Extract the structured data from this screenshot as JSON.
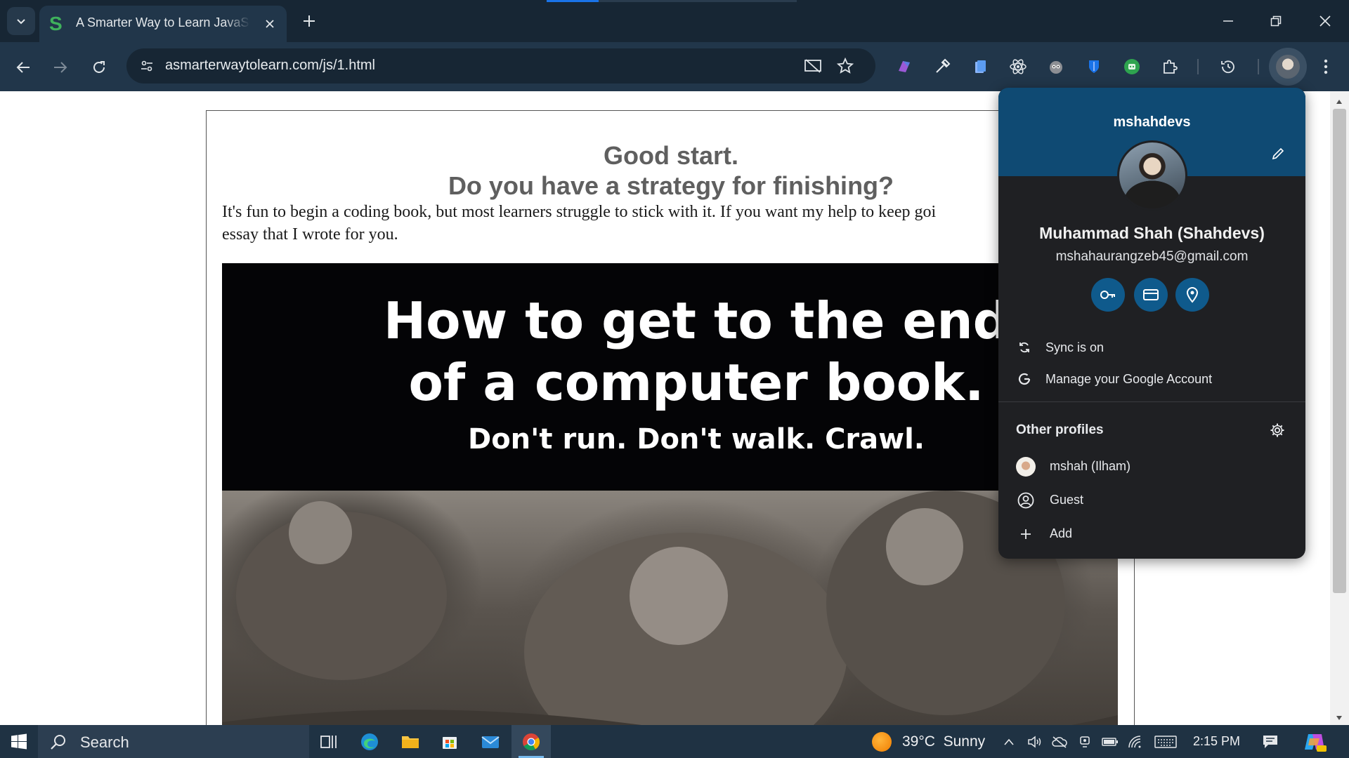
{
  "browser": {
    "tab": {
      "title": "A Smarter Way to Learn JavaScript",
      "favicon_letter": "S"
    },
    "url": "asmarterwaytolearn.com/js/1.html"
  },
  "page": {
    "heading_line1": "Good start.",
    "heading_line2": "Do you have a strategy for finishing?",
    "paragraph_line1": "It's fun to begin a coding book, but most learners struggle to stick with it. If you want my help to keep goi",
    "paragraph_line2": "essay that I wrote for you.",
    "banner": {
      "line1": "How to get to the end",
      "line2": "of a computer book.",
      "line3": "Don't run. Don't walk. Crawl."
    }
  },
  "profile_menu": {
    "profile_label": "mshahdevs",
    "full_name": "Muhammad Shah (Shahdevs)",
    "email": "mshahaurangzeb45@gmail.com",
    "sync_label": "Sync is on",
    "manage_label": "Manage your Google Account",
    "other_profiles_heading": "Other profiles",
    "other_profiles": [
      {
        "name": "mshah (Ilham)"
      },
      {
        "name": "Guest"
      },
      {
        "name": "Add"
      }
    ]
  },
  "taskbar": {
    "search_label": "Search",
    "weather_temp": "39°C",
    "weather_condition": "Sunny",
    "time": "2:15 PM"
  },
  "colors": {
    "titlebar": "#172634",
    "toolbar": "#21364a",
    "popup_header": "#0f4a73",
    "popup_body": "#1f2023",
    "taskbar": "#1f3243"
  }
}
